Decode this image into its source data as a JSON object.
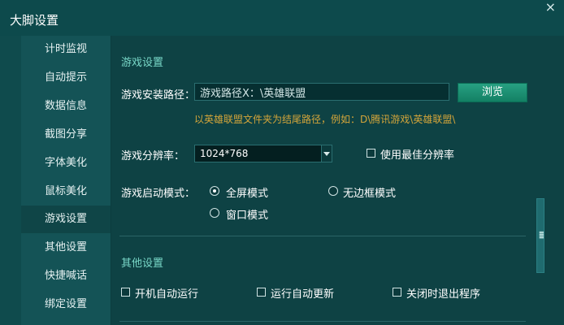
{
  "window": {
    "title": "大脚设置",
    "close_glyph": "×"
  },
  "sidebar": {
    "items": [
      {
        "label": "计时监视"
      },
      {
        "label": "自动提示"
      },
      {
        "label": "数据信息"
      },
      {
        "label": "截图分享"
      },
      {
        "label": "字体美化"
      },
      {
        "label": "鼠标美化"
      },
      {
        "label": "游戏设置",
        "active": true
      },
      {
        "label": "其他设置"
      },
      {
        "label": "快捷喊话"
      },
      {
        "label": "绑定设置"
      }
    ]
  },
  "game": {
    "section_title": "游戏设置",
    "install_label": "游戏安装路径：",
    "install_value": "游戏路径X：\\英雄联盟",
    "browse_label": "浏览",
    "hint": "以英雄联盟文件夹为结尾路径，例如：D\\腾讯游戏\\英雄联盟\\",
    "resolution_label": "游戏分辨率：",
    "resolution_value": "1024*768",
    "best_resolution_label": "使用最佳分辨率",
    "launch_label": "游戏启动模式：",
    "mode_fullscreen": "全屏模式",
    "mode_borderless": "无边框模式",
    "mode_windowed": "窗口模式"
  },
  "other": {
    "section_title": "其他设置",
    "autostart": "开机自动运行",
    "autoupdate": "运行自动更新",
    "exit_on_close": "关闭时退出程序"
  },
  "colors": {
    "accent": "#79d8c8",
    "hint": "#d4a53a",
    "button": "#1d9276"
  }
}
